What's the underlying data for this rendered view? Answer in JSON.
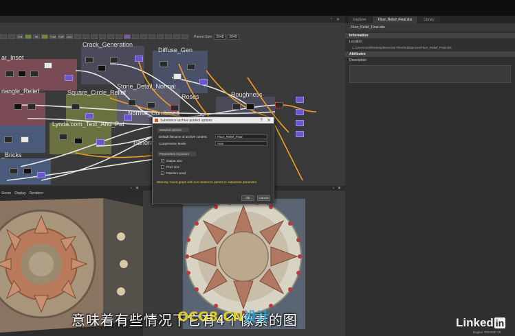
{
  "graph": {
    "frame_labels": [
      "ar_Inset",
      "Crack_Generation",
      "Diffuse_Gen",
      "riangle_Relief",
      "Square_Circle_Relief",
      "Stone_Detail_Normal",
      "Roughness",
      "Roses",
      "Normal_Combines",
      "Lynda.com_Text_And_Pat",
      "Panora",
      "_Bricks"
    ],
    "toolbar_labels": [
      "Chil",
      "Hil",
      "Fold",
      "FoR",
      "GrD"
    ],
    "parent_size_label": "Parent Size:",
    "size_a": "2048",
    "size_b": "2048"
  },
  "props": {
    "tabs": [
      "Explorer",
      "Floor_Relief_Final.sbs",
      "Library"
    ],
    "file_name": "Floor_Relief_Final.sbs",
    "information_header": "Information",
    "location_label": "Location",
    "location_value": "C:/Users/Joel/Desktop/Exercise Files/Substances/Floor_Relief_Final.sbs",
    "attributes_header": "Attributes",
    "description_label": "Description"
  },
  "view3d": {
    "menu": [
      "Scene",
      "Display",
      "Renderer"
    ]
  },
  "dialog": {
    "title": "Substance archive publish options",
    "general_section": "General options",
    "filename_label": "Default filename of archive content:",
    "filename_value": "Floor_Relief_Final",
    "compression_label": "Compression Mode:",
    "compression_value": "Auto",
    "exposure_section": "Parameters exposure",
    "checkboxes": [
      "Output size",
      "Pixel size",
      "Random seed"
    ],
    "warning": "Warning: found graph with non relative to parent x1 outputsize parameter.",
    "ok": "Ok",
    "cancel": "Cancel"
  },
  "overlay": {
    "subtitle": "意味着有些情况下它有4个像素的图",
    "watermark_a": "OCG8.CN",
    "watermark_b": "设计",
    "logo_text": "Linked",
    "logo_box": "in",
    "status": "Engine: Direct3D 10"
  },
  "colors": {
    "frame_red": "#8a4a55",
    "frame_purple": "#6a5a8a",
    "frame_olive": "#6a7040",
    "frame_blue": "#4a5a7a",
    "wire_orange": "#f0a020",
    "wire_white": "#e8e8e8",
    "warning": "#f0d04a"
  }
}
